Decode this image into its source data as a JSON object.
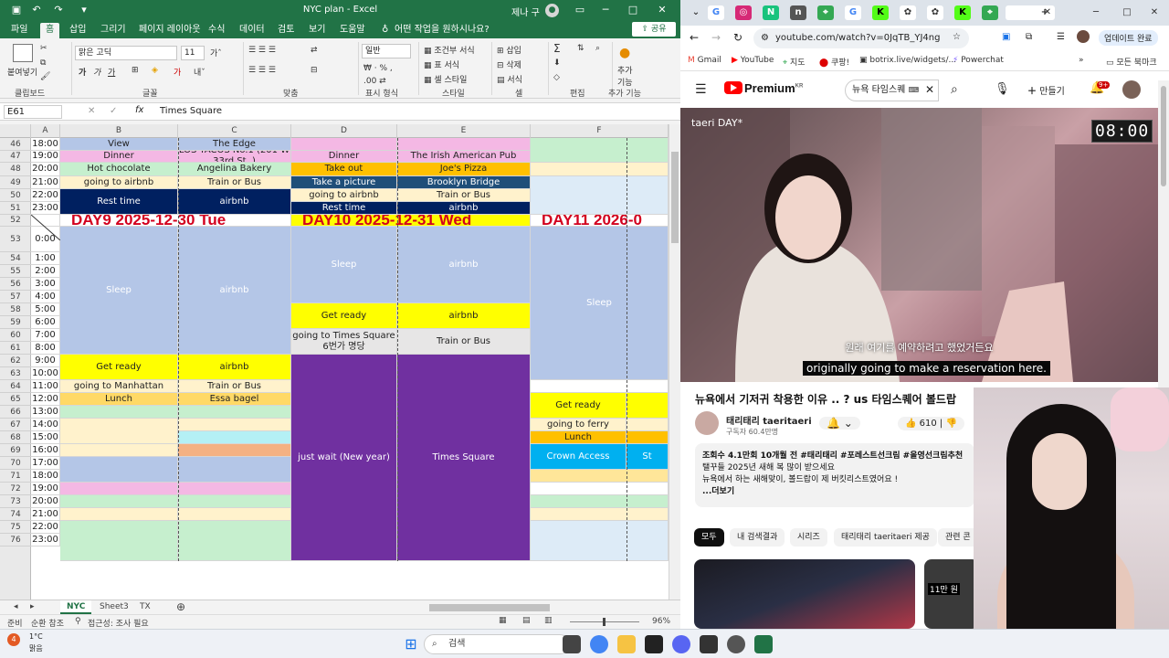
{
  "excel": {
    "title": "NYC plan  -  Excel",
    "user": "제나 구",
    "tabs": [
      "파일",
      "홈",
      "삽입",
      "그리기",
      "페이지 레이아웃",
      "수식",
      "데이터",
      "검토",
      "보기",
      "도움말"
    ],
    "tell_me": "어떤 작업을 원하시나요?",
    "share": "공유",
    "ribbon": {
      "paste": "붙여넣기",
      "font_name": "맑은 고딕",
      "font_size": "11",
      "number_format": "일반",
      "conditional": "조건부 서식",
      "table_format": "표 서식",
      "cell_style": "셀 스타일",
      "insert": "삽입",
      "delete": "삭제",
      "format": "서식",
      "add_function": "추가 기능",
      "groups": [
        "클립보드",
        "글꼴",
        "맞춤",
        "표시 형식",
        "스타일",
        "셀",
        "편집",
        "추가 기능"
      ]
    },
    "name_box": "E61",
    "formula": "Times Square",
    "columns": [
      "A",
      "B",
      "C",
      "D",
      "E",
      "F"
    ],
    "rows": [
      {
        "n": "46",
        "t": "18:00"
      },
      {
        "n": "47",
        "t": "19:00"
      },
      {
        "n": "48",
        "t": "20:00"
      },
      {
        "n": "49",
        "t": "21:00"
      },
      {
        "n": "50",
        "t": "22:00"
      },
      {
        "n": "51",
        "t": "23:00"
      },
      {
        "n": "52",
        "t": ""
      },
      {
        "n": "53",
        "t": "0:00"
      },
      {
        "n": "54",
        "t": "1:00"
      },
      {
        "n": "55",
        "t": "2:00"
      },
      {
        "n": "56",
        "t": "3:00"
      },
      {
        "n": "57",
        "t": "4:00"
      },
      {
        "n": "58",
        "t": "5:00"
      },
      {
        "n": "59",
        "t": "6:00"
      },
      {
        "n": "60",
        "t": "7:00"
      },
      {
        "n": "61",
        "t": "8:00"
      },
      {
        "n": "62",
        "t": "9:00"
      },
      {
        "n": "63",
        "t": "10:00"
      },
      {
        "n": "64",
        "t": "11:00"
      },
      {
        "n": "65",
        "t": "12:00"
      },
      {
        "n": "66",
        "t": "13:00"
      },
      {
        "n": "67",
        "t": "14:00"
      },
      {
        "n": "68",
        "t": "15:00"
      },
      {
        "n": "69",
        "t": "16:00"
      },
      {
        "n": "70",
        "t": "17:00"
      },
      {
        "n": "71",
        "t": "18:00"
      },
      {
        "n": "72",
        "t": "19:00"
      },
      {
        "n": "73",
        "t": "20:00"
      },
      {
        "n": "74",
        "t": "21:00"
      },
      {
        "n": "75",
        "t": "22:00"
      },
      {
        "n": "76",
        "t": "23:00"
      }
    ],
    "cells": {
      "b46": "View",
      "c46": "The Edge",
      "b47": "Dinner",
      "c47": "LOS TACOS No.1 (201 W 33rd St, )",
      "d47": "Dinner",
      "e47": "The Irish American Pub",
      "b48": "Hot chocolate",
      "c48": "Angelina Bakery",
      "d48": "Take out",
      "e48": "Joe's Pizza",
      "b49": "going to airbnb",
      "c49": "Train or Bus",
      "d49": "Take a picture",
      "e49": "Brooklyn Bridge",
      "b50": "Rest time",
      "c50": "airbnb",
      "d50": "going to airbnb",
      "e50": "Train or Bus",
      "d51": "Rest time",
      "e51": "airbnb",
      "day9": "DAY9  2025-12-30 Tue",
      "day10": "DAY10  2025-12-31 Wed",
      "day11": "DAY11  2026-0",
      "b_sleep": "Sleep",
      "c_sleep": "airbnb",
      "d_sleep": "Sleep",
      "e_sleep": "airbnb",
      "f_sleep": "Sleep",
      "d58": "Get ready",
      "e58": "airbnb",
      "d60": "going to Times Square 6번가 명당",
      "e60": "Train or Bus",
      "b61": "Get ready",
      "c61": "airbnb",
      "b63": "going to Manhattan",
      "c63": "Train or Bus",
      "b64": "Lunch",
      "c64": "Essa bagel",
      "d_wait": "just wait (New year)",
      "e_wait": "Times Square",
      "f64": "Get ready",
      "f66": "going to ferry",
      "f67": "Lunch",
      "f68": "Crown Access",
      "g68": "St"
    },
    "sheets": [
      "NYC",
      "Sheet3",
      "TX"
    ],
    "status": {
      "ready": "준비",
      "circular": "순환 참조",
      "accessibility": "접근성: 조사 필요",
      "zoom": "96%"
    }
  },
  "browser": {
    "url": "youtube.com/watch?v=0JqTB_YJ4ng",
    "bookmarks": [
      "Gmail",
      "YouTube",
      "지도",
      "쿠팡!",
      "botrix.live/widgets/...",
      "Powerchat",
      "모든 북마크"
    ],
    "update_button": "업데이트 완료",
    "yt": {
      "logo": "Premium",
      "logo_sup": "KR",
      "search": "뉴욕 타임스퀘",
      "create": "만들기",
      "notif_count": "9+",
      "video_brand": "taeri DAY*",
      "timer": "08:00",
      "subtitle_ko": "원래 여기를 예약하려고 했었거든요",
      "subtitle_en": "originally going to make a reservation here.",
      "title": "뉴욕에서 기저귀 착용한 이유 .. ? us 타임스퀘어 볼드랍",
      "channel": "태리태리 taeritaeri",
      "subscribers": "구독자 60.4만명",
      "likes": "610",
      "desc_line1": "조회수 4.1만회  10개월 전  #태리태리 #포레스트선크림 #올영선크림추천",
      "desc_line2": "탤꾸들 2025년 새해 복 많이 받으세요",
      "desc_line3": "뉴욕에서 하는 새해맞이, 볼드랍이 제 버킷리스트였어요 !",
      "more": "...더보기",
      "chips": [
        "모두",
        "내 검색결과",
        "시리즈",
        "태리태리 taeritaeri 제공",
        "관련 콘"
      ],
      "thumb2_label": "11만 원"
    }
  },
  "taskbar": {
    "weather_temp": "1°C",
    "weather_text": "맑음",
    "search": "검색",
    "weather_badge": "4"
  }
}
